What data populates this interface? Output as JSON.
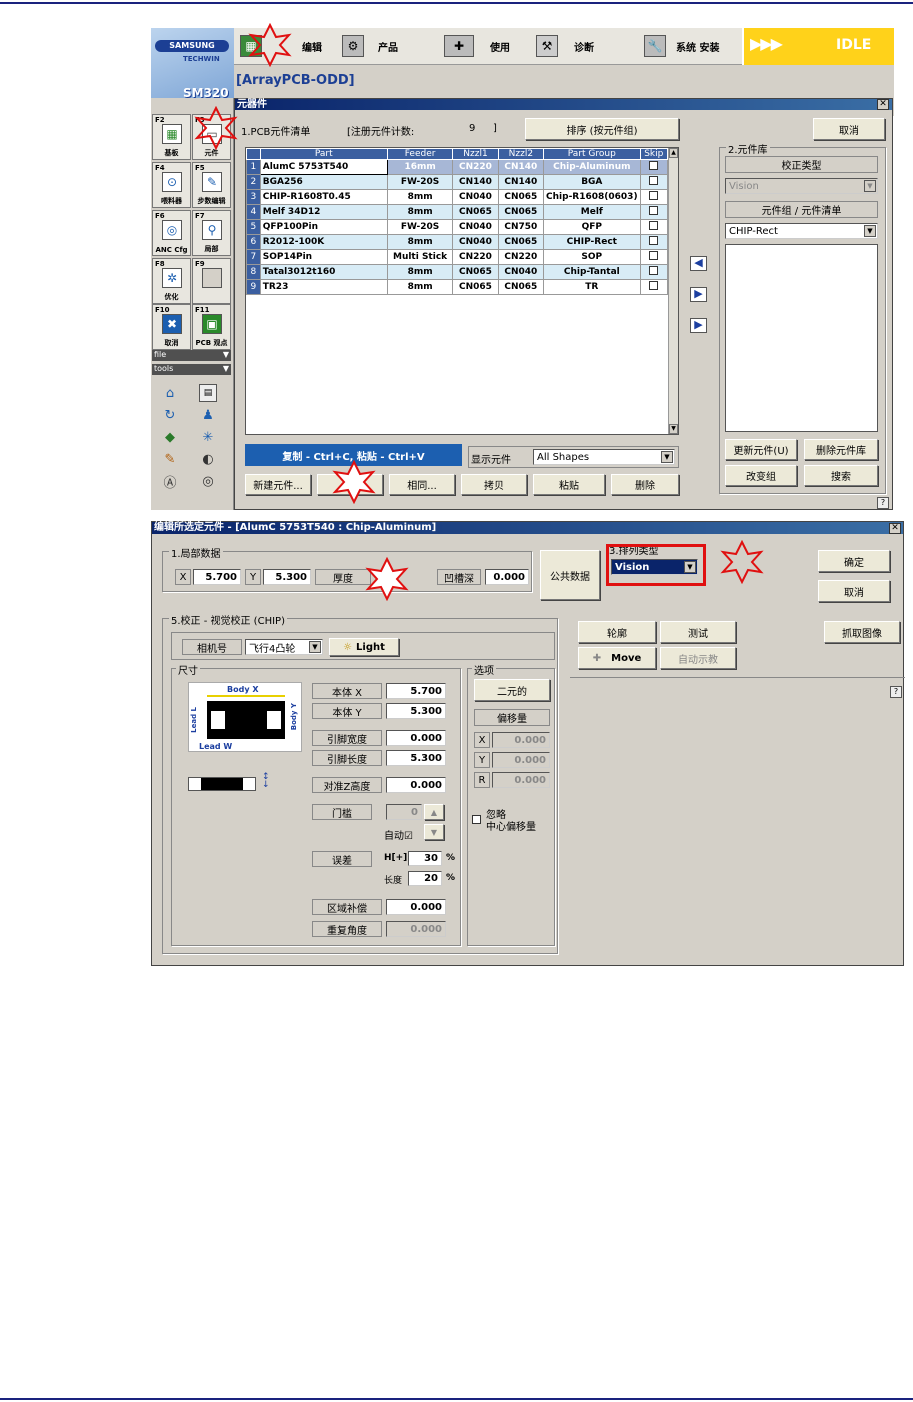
{
  "toolbar": {
    "items": [
      {
        "label": "编辑",
        "icon": "edit-icon"
      },
      {
        "label": "产品",
        "icon": "product-icon"
      },
      {
        "label": "使用",
        "icon": "use-icon"
      },
      {
        "label": "诊断",
        "icon": "diagnosis-icon"
      },
      {
        "label": "系统 安装",
        "icon": "system-setup-icon"
      }
    ],
    "status": "IDLE",
    "arrows": "▶▶▶"
  },
  "brand": {
    "name": "SAMSUNG",
    "sub": "TECHWIN",
    "model": "SM320"
  },
  "file_title": "[ArrayPCB-ODD]",
  "side": {
    "fkeys": [
      {
        "key": "F2",
        "label": "基板"
      },
      {
        "key": "F3",
        "label": "元件"
      },
      {
        "key": "F4",
        "label": "喂料器"
      },
      {
        "key": "F5",
        "label": "步数编辑"
      },
      {
        "key": "F6",
        "label": "ANC Cfg"
      },
      {
        "key": "F7",
        "label": "局部"
      },
      {
        "key": "F8",
        "label": "优化"
      },
      {
        "key": "F9",
        "label": ""
      },
      {
        "key": "F10",
        "label": "取消"
      },
      {
        "key": "F11",
        "label": "PCB 观点"
      }
    ],
    "file_label": "file",
    "tools_label": "tools"
  },
  "parts_window": {
    "title": "元器件",
    "section1": "1.PCB元件清单",
    "count_label": "[注册元件计数:",
    "count_value": "9",
    "count_close": "]",
    "sort_button": "排序 (按元件组)",
    "cancel_button": "取消",
    "columns": [
      "",
      "Part",
      "Feeder",
      "Nzzl1",
      "Nzzl2",
      "Part Group",
      "Skip"
    ],
    "rows": [
      {
        "n": "1",
        "part": "AlumC 5753T540",
        "feeder": "16mm",
        "n1": "CN220",
        "n2": "CN140",
        "group": "Chip-Aluminum"
      },
      {
        "n": "2",
        "part": "BGA256",
        "feeder": "FW-20S",
        "n1": "CN140",
        "n2": "CN140",
        "group": "BGA"
      },
      {
        "n": "3",
        "part": "CHIP-R1608T0.45",
        "feeder": "8mm",
        "n1": "CN040",
        "n2": "CN065",
        "group": "Chip-R1608(0603)"
      },
      {
        "n": "4",
        "part": "Melf 34D12",
        "feeder": "8mm",
        "n1": "CN065",
        "n2": "CN065",
        "group": "Melf"
      },
      {
        "n": "5",
        "part": "QFP100Pin",
        "feeder": "FW-20S",
        "n1": "CN040",
        "n2": "CN750",
        "group": "QFP"
      },
      {
        "n": "6",
        "part": "R2012-100K",
        "feeder": "8mm",
        "n1": "CN040",
        "n2": "CN065",
        "group": "CHIP-Rect"
      },
      {
        "n": "7",
        "part": "SOP14Pin",
        "feeder": "Multi Stick",
        "n1": "CN220",
        "n2": "CN220",
        "group": "SOP"
      },
      {
        "n": "8",
        "part": "Tatal3012t160",
        "feeder": "8mm",
        "n1": "CN065",
        "n2": "CN040",
        "group": "Chip-Tantal"
      },
      {
        "n": "9",
        "part": "TR23",
        "feeder": "8mm",
        "n1": "CN065",
        "n2": "CN065",
        "group": "TR"
      }
    ],
    "copy_hint": "复制 - Ctrl+C, 粘贴 - Ctrl+V",
    "show_label": "显示元件",
    "show_value": "All Shapes",
    "buttons": [
      "新建元件...",
      "",
      "相同...",
      "拷贝",
      "粘贴",
      "删除"
    ],
    "library": {
      "title": "2.元件库",
      "calib_label": "校正类型",
      "calib_value": "Vision",
      "group_label": "元件组 / 元件清单",
      "group_value": "CHIP-Rect",
      "update_button": "更新元件(U)",
      "delete_button": "删除元件库",
      "change_button": "改变组",
      "search_button": "搜索"
    },
    "help": "?"
  },
  "edit_window": {
    "title": "编辑所选定元件 - [AlumC 5753T540 : Chip-Aluminum]",
    "local_title": "1.局部数据",
    "x_label": "X",
    "x_value": "5.700",
    "y_label": "Y",
    "y_value": "5.300",
    "thickness_label": "厚度",
    "groove_label": "凹槽深",
    "groove_value": "0.000",
    "common_button": "公共数据",
    "align_title": "3.排列类型",
    "align_value": "Vision",
    "ok_button": "确定",
    "cancel_button": "取消",
    "calib_title": "5.校正 - 视觉校正 (CHIP)",
    "camera_label": "相机号",
    "camera_value": "飞行4凸轮",
    "light_button": "Light",
    "outline_button": "轮廓",
    "test_button": "测试",
    "grab_button": "抓取图像",
    "move_button": "Move",
    "auto_teach_button": "自动示教",
    "size_title": "尺寸",
    "diagram": {
      "body_x": "Body X",
      "body_y": "Body Y",
      "lead_l": "Lead L",
      "lead_w": "Lead W"
    },
    "fields": {
      "body_x": {
        "label": "本体 X",
        "value": "5.700"
      },
      "body_y": {
        "label": "本体 Y",
        "value": "5.300"
      },
      "lead_width": {
        "label": "引脚宽度",
        "value": "0.000"
      },
      "lead_length": {
        "label": "引脚长度",
        "value": "5.300"
      },
      "align_z": {
        "label": "对准Z高度",
        "value": "0.000"
      },
      "threshold": {
        "label": "门槛",
        "value": "0"
      },
      "auto_label": "自动☑",
      "error": {
        "label": "误差",
        "h_label": "H[+]",
        "h_value": "30",
        "len_label": "长度",
        "len_value": "20",
        "unit": "%"
      },
      "area_comp": {
        "label": "区域补偿",
        "value": "0.000"
      },
      "repeat_angle": {
        "label": "重复角度",
        "value": "0.000"
      }
    },
    "options": {
      "title": "选项",
      "binary_button": "二元的",
      "offset_label": "偏移量",
      "x_label": "X",
      "x_value": "0.000",
      "y_label": "Y",
      "y_value": "0.000",
      "r_label": "R",
      "r_value": "0.000",
      "ignore_label": "忽略",
      "center_label": "中心偏移量"
    },
    "help": "?"
  },
  "colors": {
    "title_bar": "#0a246a",
    "highlight": "#e01010",
    "status_bg": "#ffd21a",
    "grid_header": "#3b5fa0"
  }
}
